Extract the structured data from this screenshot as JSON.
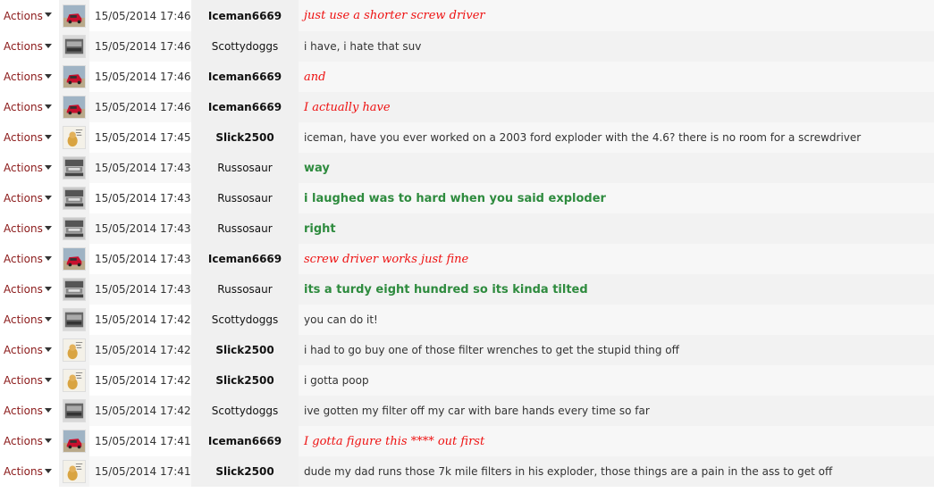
{
  "actions_label": "Actions",
  "colors": {
    "actions_text": "#8b1a1a",
    "red_message": "#ee1111",
    "green_message": "#2e8b3e"
  },
  "messages": [
    {
      "avatar": "red-car-avatar",
      "time": "15/05/2014 17:46",
      "user": "Iceman6669",
      "user_bold": true,
      "text": "just use a shorter screw driver",
      "style": "red"
    },
    {
      "avatar": "gray-car-avatar",
      "time": "15/05/2014 17:46",
      "user": "Scottydoggs",
      "user_bold": false,
      "text": "i have, i hate that suv",
      "style": "plain"
    },
    {
      "avatar": "red-car-avatar",
      "time": "15/05/2014 17:46",
      "user": "Iceman6669",
      "user_bold": true,
      "text": "and",
      "style": "red"
    },
    {
      "avatar": "red-car-avatar",
      "time": "15/05/2014 17:46",
      "user": "Iceman6669",
      "user_bold": true,
      "text": "I actually have",
      "style": "red"
    },
    {
      "avatar": "dog-avatar",
      "time": "15/05/2014 17:45",
      "user": "Slick2500",
      "user_bold": true,
      "text": "iceman, have you ever worked on a 2003 ford exploder with the 4.6? there is no room for a screwdriver",
      "style": "plain"
    },
    {
      "avatar": "truck-avatar",
      "time": "15/05/2014 17:43",
      "user": "Russosaur",
      "user_bold": false,
      "text": "way",
      "style": "green"
    },
    {
      "avatar": "truck-avatar",
      "time": "15/05/2014 17:43",
      "user": "Russosaur",
      "user_bold": false,
      "text": "i laughed was to hard when you said exploder",
      "style": "green"
    },
    {
      "avatar": "truck-avatar",
      "time": "15/05/2014 17:43",
      "user": "Russosaur",
      "user_bold": false,
      "text": "right",
      "style": "green"
    },
    {
      "avatar": "red-car-avatar",
      "time": "15/05/2014 17:43",
      "user": "Iceman6669",
      "user_bold": true,
      "text": "screw driver works just fine",
      "style": "red"
    },
    {
      "avatar": "truck-avatar",
      "time": "15/05/2014 17:43",
      "user": "Russosaur",
      "user_bold": false,
      "text": "its a turdy eight hundred so its kinda tilted",
      "style": "green"
    },
    {
      "avatar": "gray-car-avatar",
      "time": "15/05/2014 17:42",
      "user": "Scottydoggs",
      "user_bold": false,
      "text": "you can do it!",
      "style": "plain"
    },
    {
      "avatar": "dog-avatar",
      "time": "15/05/2014 17:42",
      "user": "Slick2500",
      "user_bold": true,
      "text": "i had to go buy one of those filter wrenches to get the stupid thing off",
      "style": "plain"
    },
    {
      "avatar": "dog-avatar",
      "time": "15/05/2014 17:42",
      "user": "Slick2500",
      "user_bold": true,
      "text": "i gotta poop",
      "style": "plain"
    },
    {
      "avatar": "gray-car-avatar",
      "time": "15/05/2014 17:42",
      "user": "Scottydoggs",
      "user_bold": false,
      "text": "ive gotten my filter off my car with bare hands every time so far",
      "style": "plain"
    },
    {
      "avatar": "red-car-avatar",
      "time": "15/05/2014 17:41",
      "user": "Iceman6669",
      "user_bold": true,
      "text": "I gotta figure this **** out first",
      "style": "red"
    },
    {
      "avatar": "dog-avatar",
      "time": "15/05/2014 17:41",
      "user": "Slick2500",
      "user_bold": true,
      "text": "dude my dad runs those 7k mile filters in his exploder, those things are a pain in the ass to get off",
      "style": "plain"
    }
  ]
}
